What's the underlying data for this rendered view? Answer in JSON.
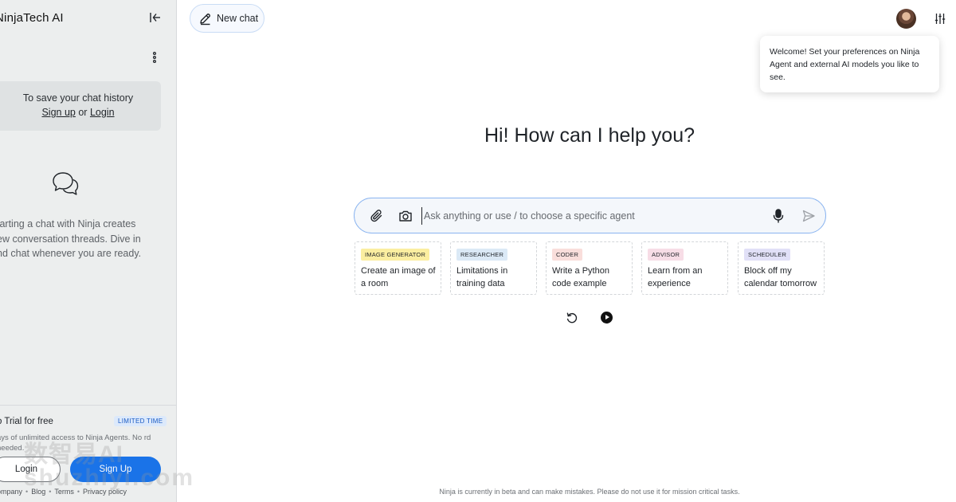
{
  "sidebar": {
    "brand": "NinjaTech AI",
    "save_history_text": "To save your chat history",
    "sign_up_link": "Sign up",
    "or_text": " or ",
    "login_link": "Login",
    "empty_state_text": "tarting a chat with Ninja creates ew conversation threads. Dive in nd chat whenever you are ready.",
    "promo": {
      "title": "o Trial for free",
      "badge": "LIMITED TIME",
      "description": "ays of unlimited access to Ninja Agents. No rd needed."
    },
    "login_button": "Login",
    "signup_button": "Sign Up",
    "footer_links": [
      "ompany",
      "Blog",
      "Terms",
      "Privacy policy"
    ]
  },
  "header": {
    "new_chat_label": "New chat"
  },
  "tooltip": {
    "text": "Welcome! Set your preferences on Ninja Agent and external AI models you like to see."
  },
  "main": {
    "greeting": "Hi! How can I help you?",
    "input_placeholder": "Ask anything or use / to choose a specific agent",
    "cards": [
      {
        "tag": "IMAGE GENERATOR",
        "tag_color": "#fbeea0",
        "text": "Create an image of a room"
      },
      {
        "tag": "RESEARCHER",
        "tag_color": "#dbe9f6",
        "text": "Limitations in training data"
      },
      {
        "tag": "CODER",
        "tag_color": "#f9dedb",
        "text": "Write a Python code example"
      },
      {
        "tag": "ADVISOR",
        "tag_color": "#f7dde6",
        "text": "Learn from an experience"
      },
      {
        "tag": "SCHEDULER",
        "tag_color": "#e1e0f7",
        "text": "Block off my calendar tomorrow"
      }
    ],
    "disclaimer": "Ninja is currently in beta and can make mistakes. Please do not use it for mission critical tasks."
  },
  "watermark": {
    "line1": "数智易AI",
    "line2": "shuzhiyi.com"
  }
}
